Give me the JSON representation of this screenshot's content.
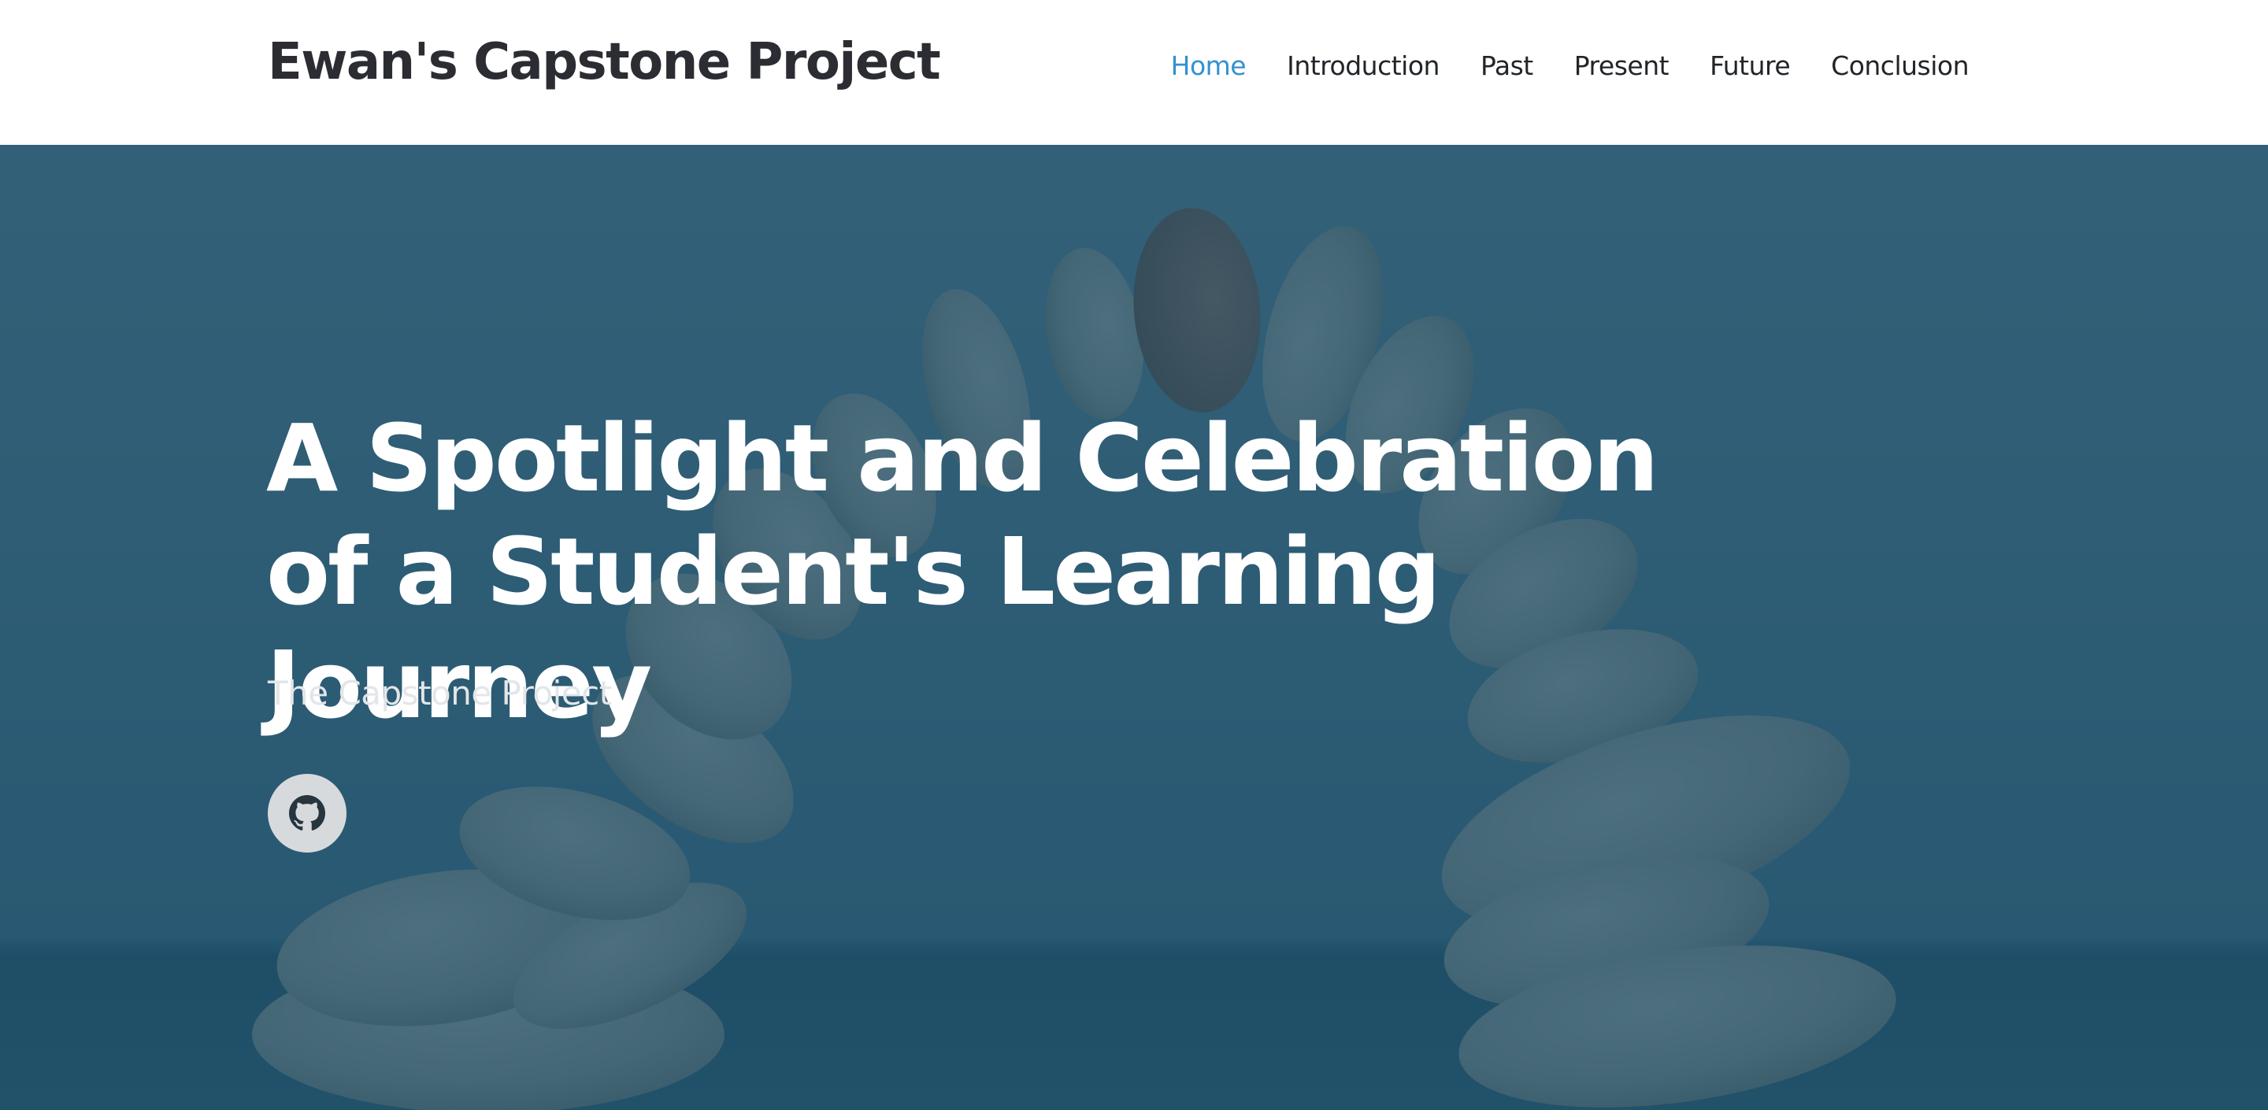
{
  "header": {
    "brand": "Ewan's Capstone Project",
    "nav": [
      {
        "label": "Home",
        "active": true
      },
      {
        "label": "Introduction",
        "active": false
      },
      {
        "label": "Past",
        "active": false
      },
      {
        "label": "Present",
        "active": false
      },
      {
        "label": "Future",
        "active": false
      },
      {
        "label": "Conclusion",
        "active": false
      }
    ]
  },
  "hero": {
    "title": "A Spotlight and Celebration of a Student's Learning Journey",
    "subtitle": "The Capstone Project",
    "social_icon": "github-icon"
  },
  "colors": {
    "nav_active": "#3391d1",
    "nav_text": "#212529",
    "brand_text": "#2b2d33",
    "hero_overlay": "#1f4a60",
    "hero_text": "#ffffff",
    "social_button_bg": "#d7dadc"
  }
}
